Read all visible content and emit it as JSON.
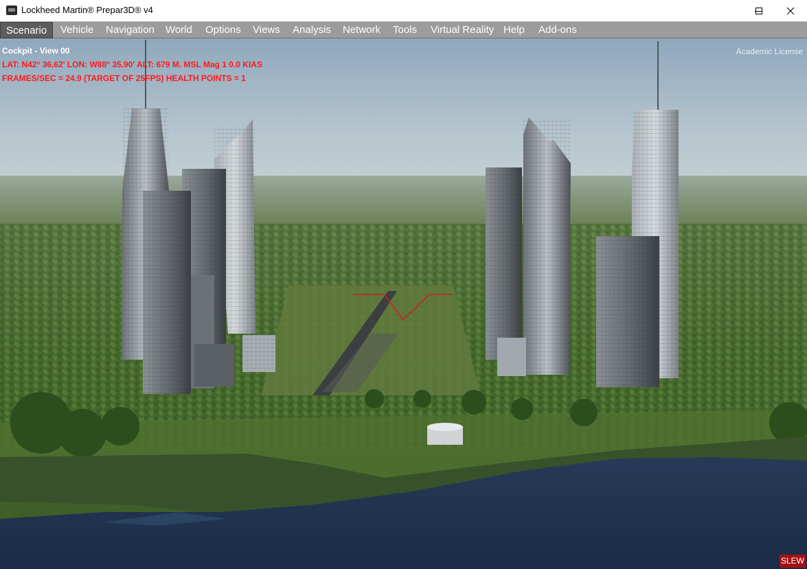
{
  "window": {
    "title": "Lockheed Martin® Prepar3D® v4"
  },
  "menu": {
    "items": [
      {
        "label": "Scenario",
        "active": true
      },
      {
        "label": "Vehicle"
      },
      {
        "label": "Navigation"
      },
      {
        "label": "World"
      },
      {
        "label": "Options"
      },
      {
        "label": "Views"
      },
      {
        "label": "Analysis"
      },
      {
        "label": "Network"
      },
      {
        "label": "Tools"
      },
      {
        "label": "Virtual Reality"
      },
      {
        "label": "Help"
      },
      {
        "label": "Add-ons"
      }
    ]
  },
  "viewport": {
    "view_title": "Cockpit - View 00",
    "license": "Academic License",
    "hud_line1": "LAT: N42° 36.62'  LON: W88° 35.90'  ALT: 679 M.  MSL   Mag  1  0.0 KIAS",
    "hud_line2": "FRAMES/SEC = 24.9   (TARGET OF 25FPS)   HEALTH POINTS = 1",
    "slew_label": "SLEW"
  },
  "colors": {
    "hud_text": "#ff1a1a",
    "slew_bg": "#a31212",
    "menubar": "#9c9c9c",
    "menu_active": "#5d5d5d"
  },
  "icons": {
    "app": "p3d-app-icon",
    "minimize": "minimize-icon",
    "maximize": "maximize-icon",
    "close": "close-icon"
  }
}
